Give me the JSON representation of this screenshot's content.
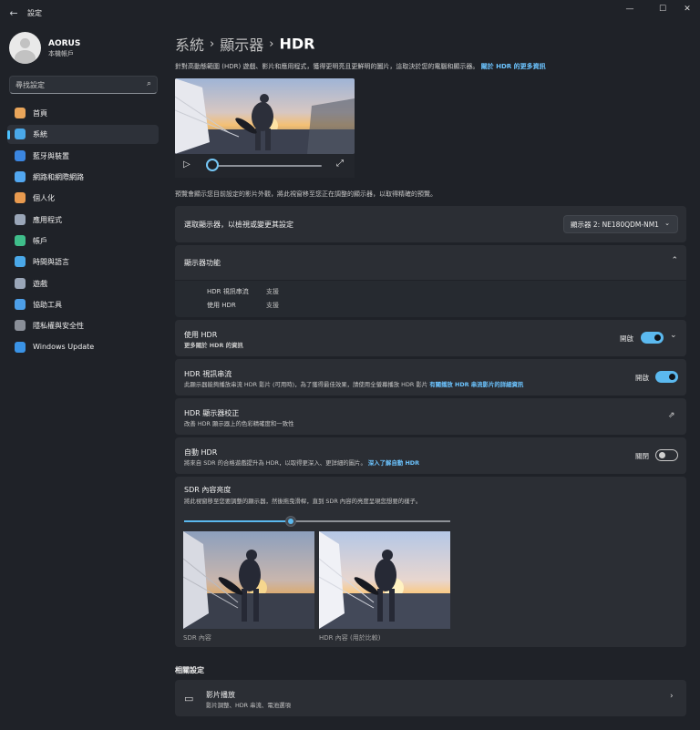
{
  "window": {
    "title": "設定",
    "controls": {
      "minimize": "—",
      "maximize": "☐",
      "close": "✕"
    }
  },
  "user": {
    "name": "AORUS",
    "account_type": "本機帳戶"
  },
  "search": {
    "placeholder": "尋找設定"
  },
  "nav": [
    {
      "label": "首頁",
      "icon": "home-icon",
      "color": "#e9a55a"
    },
    {
      "label": "系統",
      "icon": "system-display-icon",
      "color": "#4aa8e8"
    },
    {
      "label": "藍牙與裝置",
      "icon": "bluetooth-icon",
      "color": "#3b86e0"
    },
    {
      "label": "網路和網際網路",
      "icon": "wifi-icon",
      "color": "#52a7f0"
    },
    {
      "label": "個人化",
      "icon": "brush-icon",
      "color": "#e89a4f"
    },
    {
      "label": "應用程式",
      "icon": "apps-icon",
      "color": "#9aa6b8"
    },
    {
      "label": "帳戶",
      "icon": "account-icon",
      "color": "#3fbd8a"
    },
    {
      "label": "時間與語言",
      "icon": "globe-clock-icon",
      "color": "#4aa8e8"
    },
    {
      "label": "遊戲",
      "icon": "gamepad-icon",
      "color": "#9aa6b8"
    },
    {
      "label": "協助工具",
      "icon": "accessibility-icon",
      "color": "#4d9fe8"
    },
    {
      "label": "隱私權與安全性",
      "icon": "shield-icon",
      "color": "#8a8f98"
    },
    {
      "label": "Windows Update",
      "icon": "update-icon",
      "color": "#3a93e6"
    }
  ],
  "breadcrumb": [
    "系統",
    "顯示器",
    "HDR"
  ],
  "intro": {
    "text": "針對高動態範圍 (HDR) 遊戲、影片和應用程式，獲得更明亮且更鮮明的圖片，這取決於您的電腦和顯示器。",
    "link": "關於 HDR 的更多資訊"
  },
  "preview_note": "預覽會顯示您目前設定的影片外觀，將此視窗移至您正在調整的顯示器，以取得精確的預覽。",
  "select_display": {
    "label": "選取顯示器，以檢視或變更其設定",
    "value": "顯示器 2: NE180QDM-NM1"
  },
  "display_caps": {
    "title": "顯示器功能",
    "rows": [
      {
        "label": "HDR 視訊串流",
        "value": "支援"
      },
      {
        "label": "使用 HDR",
        "value": "支援"
      }
    ]
  },
  "use_hdr": {
    "title": "使用 HDR",
    "link": "更多關於 HDR 的資訊",
    "state": "開啟"
  },
  "hdr_video": {
    "title": "HDR 視訊串流",
    "desc": "此顯示器能夠播放串流 HDR 影片 (可用時)，為了獲得最佳效果，請使用全螢幕播放 HDR 影片",
    "link": "有關播放 HDR 串流影片的詳細資訊",
    "state": "開啟"
  },
  "calibration": {
    "title": "HDR 顯示器校正",
    "desc": "改善 HDR 顯示器上的色彩精確度和一致性"
  },
  "auto_hdr": {
    "title": "自動 HDR",
    "desc": "將來自 SDR 的合格遊戲提升為 HDR，以取得更深入、更詳細的圖片。",
    "link": "深入了解自動 HDR",
    "state": "關閉"
  },
  "sdr": {
    "title": "SDR 內容亮度",
    "desc": "將此視窗移至您要調整的顯示器，然後拖曳滑桿，直到 SDR 內容的亮度呈現您想要的樣子。",
    "slider_value": 0.4,
    "left_label": "SDR 內容",
    "right_label": "HDR 內容 (用於比較)"
  },
  "related": {
    "heading": "相關設定",
    "item_title": "影片播放",
    "item_desc": "影片調整、HDR 串流、電池選項"
  }
}
